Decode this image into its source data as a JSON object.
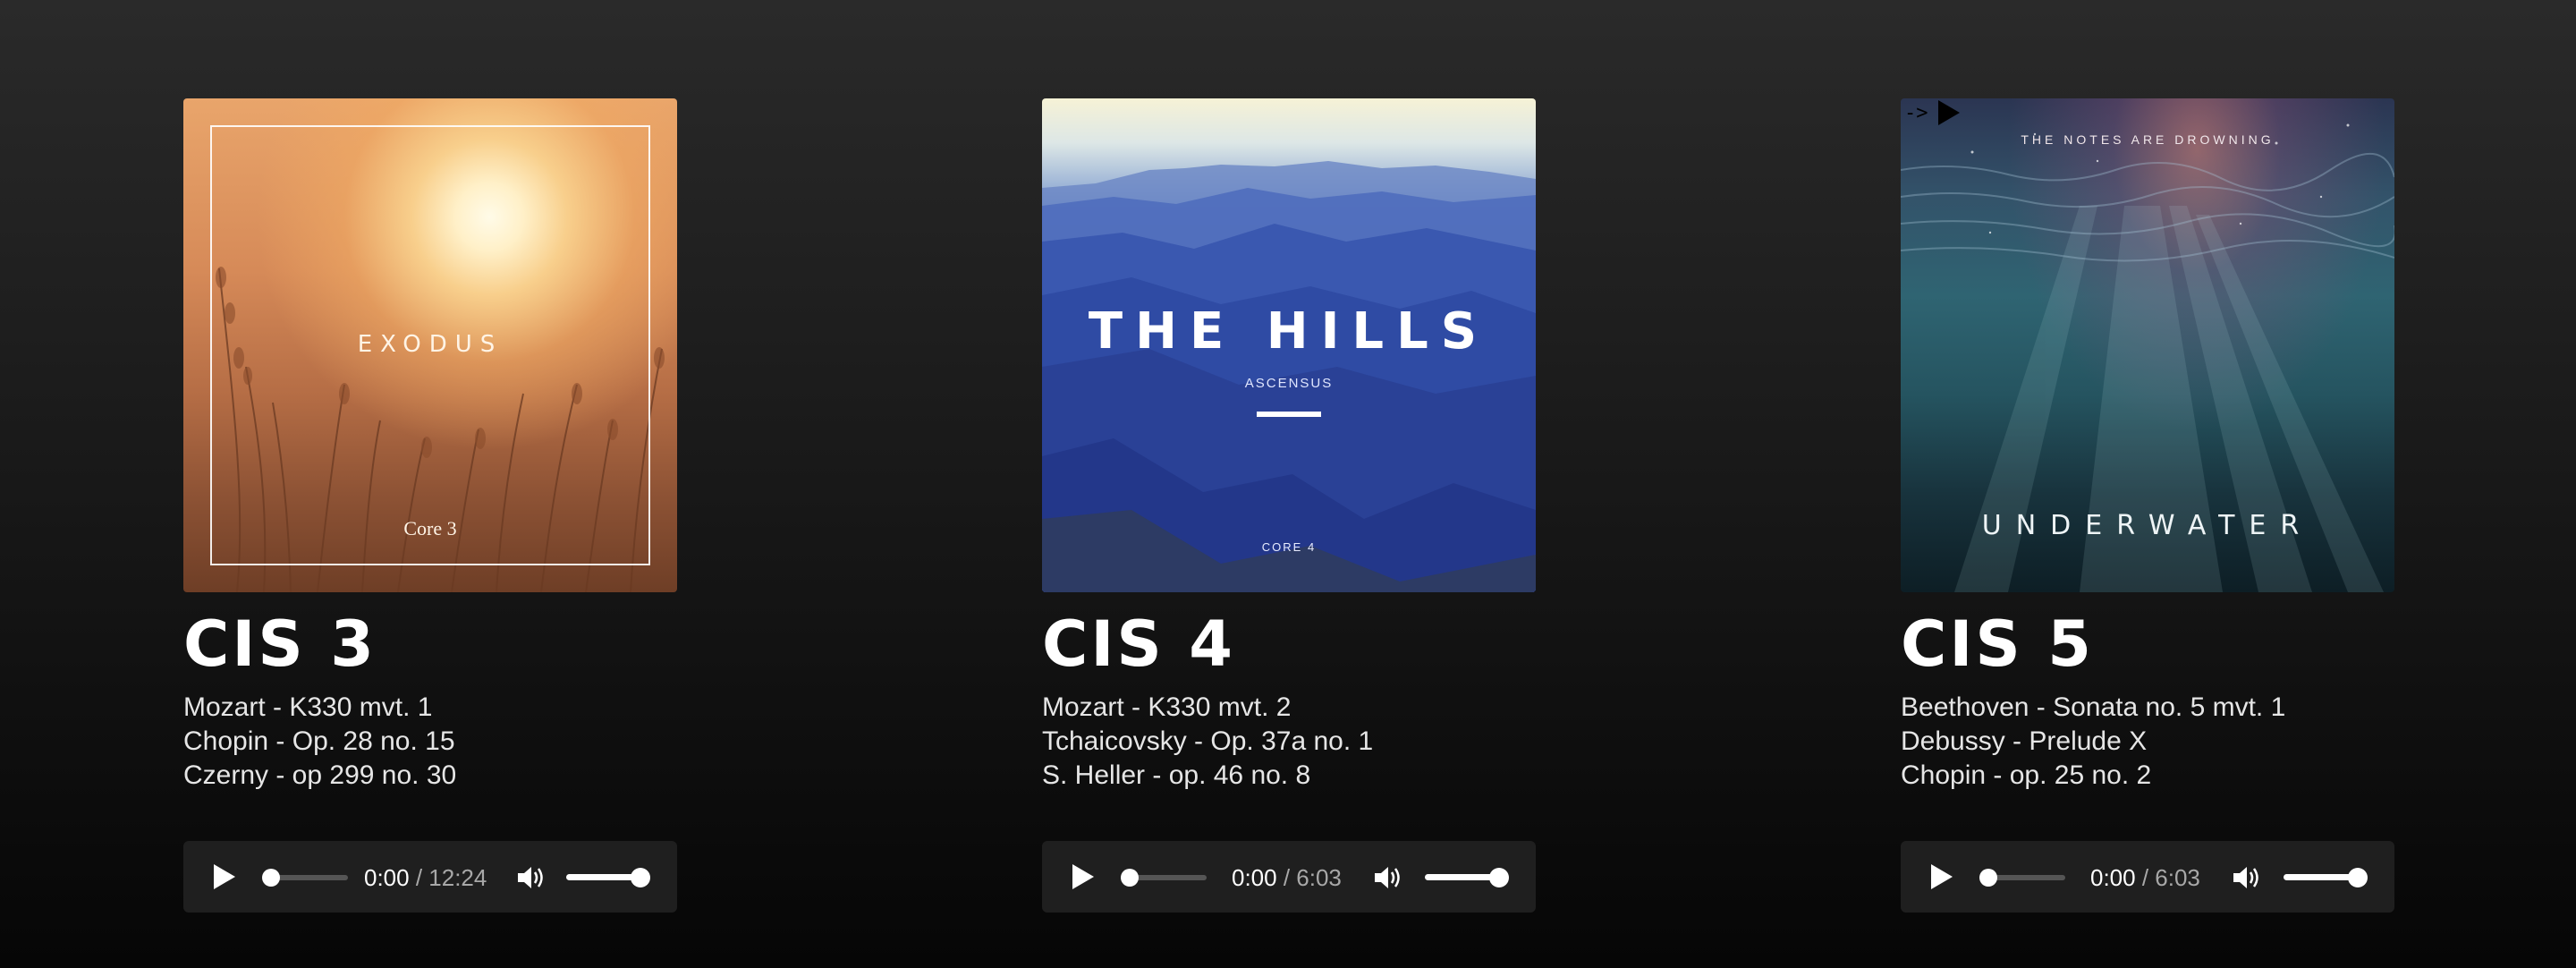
{
  "albums": [
    {
      "title": "CIS 3",
      "cover": {
        "title": "EXODUS",
        "subtitle": "Core 3"
      },
      "tracks": [
        "Mozart - K330 mvt. 1",
        "Chopin - Op. 28 no. 15",
        "Czerny - op 299 no. 30"
      ],
      "player": {
        "current": "0:00",
        "separator": " / ",
        "duration": "12:24",
        "progress": 0,
        "volume": 1
      }
    },
    {
      "title": "CIS 4",
      "cover": {
        "title": "THE HILLS",
        "subtitle": "ASCENSUS",
        "footer": "CORE 4"
      },
      "tracks": [
        "Mozart - K330 mvt. 2",
        "Tchaicovsky - Op. 37a no. 1",
        "S. Heller - op. 46 no. 8"
      ],
      "player": {
        "current": "0:00",
        "separator": " / ",
        "duration": "6:03",
        "progress": 0,
        "volume": 1
      }
    },
    {
      "title": "CIS 5",
      "cover": {
        "title": "UNDERWATER",
        "top_text": "THE NOTES ARE DROWNING",
        "arrow": "->"
      },
      "tracks": [
        "Beethoven - Sonata no. 5 mvt. 1",
        "Debussy - Prelude X",
        "Chopin - op. 25 no. 2"
      ],
      "player": {
        "current": "0:00",
        "separator": " / ",
        "duration": "6:03",
        "progress": 0,
        "volume": 1
      }
    }
  ],
  "icons": {
    "play": "play-icon",
    "volume": "volume-icon"
  },
  "colors": {
    "background_top": "#2a2a2a",
    "background_bottom": "#060606",
    "player_bg": "#1f1f1f",
    "text": "#ffffff",
    "muted_text": "#a8a8a8"
  }
}
